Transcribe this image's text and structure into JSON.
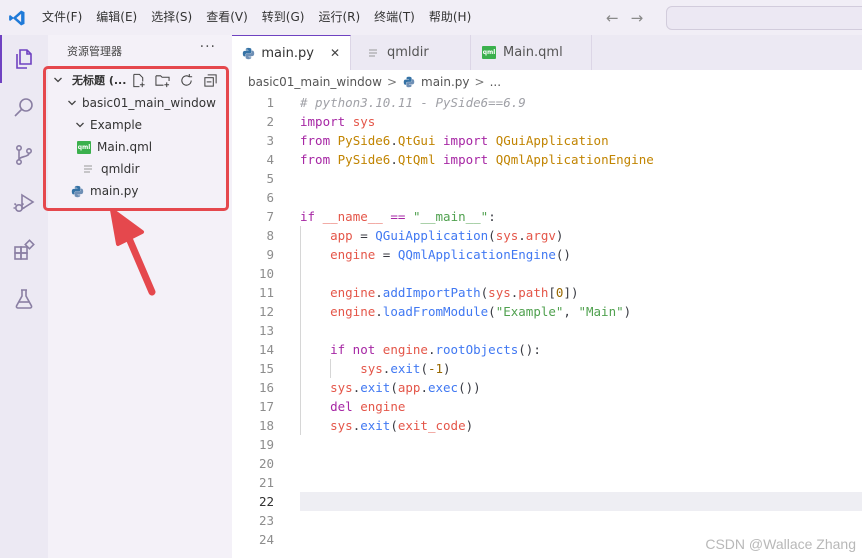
{
  "menu": [
    "文件(F)",
    "编辑(E)",
    "选择(S)",
    "查看(V)",
    "转到(G)",
    "运行(R)",
    "终端(T)",
    "帮助(H)"
  ],
  "nav": {
    "back": "←",
    "forward": "→"
  },
  "sidebar": {
    "title": "资源管理器",
    "more": "···",
    "workspace_title": "无标题 (...",
    "tree": [
      {
        "label": "basic01_main_window",
        "type": "folder"
      },
      {
        "label": "Example",
        "type": "folder"
      },
      {
        "label": "Main.qml",
        "type": "qml"
      },
      {
        "label": "qmldir",
        "type": "text"
      },
      {
        "label": "main.py",
        "type": "python"
      }
    ]
  },
  "tabs": [
    {
      "label": "main.py",
      "close": "✕",
      "icon": "python-icon"
    },
    {
      "label": "qmldir",
      "icon": "lines-icon"
    },
    {
      "label": "Main.qml",
      "icon": "qml-icon"
    }
  ],
  "qml_badge": "qml",
  "breadcrumb": {
    "folder": "basic01_main_window",
    "file": "main.py",
    "more": "...",
    "sep": ">"
  },
  "editor": {
    "current_line": 22,
    "lines": [
      [
        [
          "cm",
          "# python3.10.11 - PySide6==6.9"
        ]
      ],
      [
        [
          "kw",
          "import"
        ],
        [
          "pl",
          " "
        ],
        [
          "var",
          "sys"
        ]
      ],
      [
        [
          "kw",
          "from"
        ],
        [
          "pl",
          " "
        ],
        [
          "mod",
          "PySide6"
        ],
        [
          "pl",
          "."
        ],
        [
          "mod",
          "QtGui"
        ],
        [
          "pl",
          " "
        ],
        [
          "kw",
          "import"
        ],
        [
          "pl",
          " "
        ],
        [
          "mod",
          "QGuiApplication"
        ]
      ],
      [
        [
          "kw",
          "from"
        ],
        [
          "pl",
          " "
        ],
        [
          "mod",
          "PySide6"
        ],
        [
          "pl",
          "."
        ],
        [
          "mod",
          "QtQml"
        ],
        [
          "pl",
          " "
        ],
        [
          "kw",
          "import"
        ],
        [
          "pl",
          " "
        ],
        [
          "mod",
          "QQmlApplicationEngine"
        ]
      ],
      [],
      [],
      [
        [
          "kw",
          "if"
        ],
        [
          "pl",
          " "
        ],
        [
          "var",
          "__name__"
        ],
        [
          "pl",
          " "
        ],
        [
          "kw",
          "=="
        ],
        [
          "pl",
          " "
        ],
        [
          "str",
          "\"__main__\""
        ],
        [
          "pl",
          ":"
        ]
      ],
      [
        [
          "pl",
          "    "
        ],
        [
          "var",
          "app"
        ],
        [
          "pl",
          " = "
        ],
        [
          "fn",
          "QGuiApplication"
        ],
        [
          "pl",
          "("
        ],
        [
          "var",
          "sys"
        ],
        [
          "pl",
          "."
        ],
        [
          "var",
          "argv"
        ],
        [
          "pl",
          ")"
        ]
      ],
      [
        [
          "pl",
          "    "
        ],
        [
          "var",
          "engine"
        ],
        [
          "pl",
          " = "
        ],
        [
          "fn",
          "QQmlApplicationEngine"
        ],
        [
          "pl",
          "()"
        ]
      ],
      [],
      [
        [
          "pl",
          "    "
        ],
        [
          "var",
          "engine"
        ],
        [
          "pl",
          "."
        ],
        [
          "fn",
          "addImportPath"
        ],
        [
          "pl",
          "("
        ],
        [
          "var",
          "sys"
        ],
        [
          "pl",
          "."
        ],
        [
          "var",
          "path"
        ],
        [
          "pl",
          "["
        ],
        [
          "num",
          "0"
        ],
        [
          "pl",
          "])"
        ]
      ],
      [
        [
          "pl",
          "    "
        ],
        [
          "var",
          "engine"
        ],
        [
          "pl",
          "."
        ],
        [
          "fn",
          "loadFromModule"
        ],
        [
          "pl",
          "("
        ],
        [
          "str",
          "\"Example\""
        ],
        [
          "pl",
          ", "
        ],
        [
          "str",
          "\"Main\""
        ],
        [
          "pl",
          ")"
        ]
      ],
      [],
      [
        [
          "pl",
          "    "
        ],
        [
          "kw",
          "if not"
        ],
        [
          "pl",
          " "
        ],
        [
          "var",
          "engine"
        ],
        [
          "pl",
          "."
        ],
        [
          "fn",
          "rootObjects"
        ],
        [
          "pl",
          "():"
        ]
      ],
      [
        [
          "pl",
          "        "
        ],
        [
          "var",
          "sys"
        ],
        [
          "pl",
          "."
        ],
        [
          "fn",
          "exit"
        ],
        [
          "pl",
          "("
        ],
        [
          "num",
          "-1"
        ],
        [
          "pl",
          ")"
        ]
      ],
      [
        [
          "pl",
          "    "
        ],
        [
          "var",
          "sys"
        ],
        [
          "pl",
          "."
        ],
        [
          "fn",
          "exit"
        ],
        [
          "pl",
          "("
        ],
        [
          "var",
          "app"
        ],
        [
          "pl",
          "."
        ],
        [
          "fn",
          "exec"
        ],
        [
          "pl",
          "())"
        ]
      ],
      [
        [
          "pl",
          "    "
        ],
        [
          "kw",
          "del"
        ],
        [
          "pl",
          " "
        ],
        [
          "var",
          "engine"
        ]
      ],
      [
        [
          "pl",
          "    "
        ],
        [
          "var",
          "sys"
        ],
        [
          "pl",
          "."
        ],
        [
          "fn",
          "exit"
        ],
        [
          "pl",
          "("
        ],
        [
          "var",
          "exit_code"
        ],
        [
          "pl",
          ")"
        ]
      ],
      [],
      [],
      [],
      [],
      [],
      []
    ]
  },
  "watermark": "CSDN @Wallace Zhang"
}
